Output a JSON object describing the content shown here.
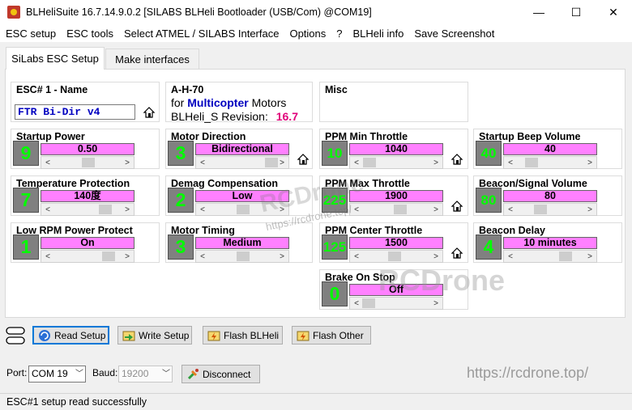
{
  "window": {
    "title": "BLHeliSuite 16.7.14.9.0.2  [SILABS BLHeli Bootloader (USB/Com) @COM19]",
    "minimize": "—",
    "maximize": "☐",
    "close": "✕"
  },
  "menu": [
    "ESC setup",
    "ESC tools",
    "Select ATMEL / SILABS Interface",
    "Options",
    "?",
    "BLHeli info",
    "Save Screenshot"
  ],
  "tabs": [
    "SiLabs ESC Setup",
    "Make interfaces"
  ],
  "esc_name": {
    "title": "ESC# 1 - Name",
    "value": "FTR Bi-Dir v4"
  },
  "esc_info": {
    "model": "A-H-70",
    "for_label": "for",
    "type": "Multicopter",
    "motors_label": "Motors",
    "revision_label": "BLHeli_S Revision:",
    "revision": "16.7"
  },
  "misc_title": "Misc",
  "params": {
    "startup_power": {
      "title": "Startup Power",
      "num": "9",
      "value": "0.50",
      "slider_level": 0.5
    },
    "motor_direction": {
      "title": "Motor Direction",
      "num": "3",
      "value": "Bidirectional",
      "slider_level": 1.0
    },
    "ppm_min": {
      "title": "PPM Min Throttle",
      "num": "10",
      "value": "1040",
      "slider_level": 0.02
    },
    "startup_beep": {
      "title": "Startup Beep Volume",
      "num": "40",
      "value": "40",
      "slider_level": 0.15
    },
    "temp_protection": {
      "title": "Temperature Protection",
      "num": "7",
      "value": "140度",
      "slider_level": 0.8
    },
    "demag": {
      "title": "Demag Compensation",
      "num": "2",
      "value": "Low",
      "slider_level": 0.5
    },
    "ppm_max": {
      "title": "PPM Max Throttle",
      "num": "225",
      "value": "1900",
      "slider_level": 0.56
    },
    "beacon_volume": {
      "title": "Beacon/Signal Volume",
      "num": "80",
      "value": "80",
      "slider_level": 0.32
    },
    "low_rpm": {
      "title": "Low RPM Power Protect",
      "num": "1",
      "value": "On",
      "slider_level": 0.85
    },
    "motor_timing": {
      "title": "Motor Timing",
      "num": "3",
      "value": "Medium",
      "slider_level": 0.5
    },
    "ppm_center": {
      "title": "PPM Center Throttle",
      "num": "125",
      "value": "1500",
      "slider_level": 0.45
    },
    "beacon_delay": {
      "title": "Beacon Delay",
      "num": "4",
      "value": "10 minutes",
      "slider_level": 0.75
    },
    "brake_on_stop": {
      "title": "Brake On Stop",
      "num": "0",
      "value": "Off",
      "slider_level": 0.0
    }
  },
  "buttons": {
    "read_setup": "Read Setup",
    "write_setup": "Write Setup",
    "flash_blheli": "Flash BLHeli",
    "flash_other": "Flash Other",
    "disconnect": "Disconnect"
  },
  "port": {
    "port_label": "Port:",
    "port_value": "COM 19",
    "baud_label": "Baud:",
    "baud_value": "19200"
  },
  "status": "ESC#1 setup read successfully",
  "watermarks": {
    "mid": "RCDrone",
    "mid_url": "https://rcdrone.top/",
    "right": "RCDrone",
    "bottom_url": "https://rcdrone.top/"
  },
  "colors": {
    "value_bg": "#ff80ff",
    "number_fg": "#00ff00",
    "number_bg": "#808080",
    "accent": "#0078d7",
    "highlight_text": "#0000c0",
    "revision_text": "#e0007a"
  }
}
